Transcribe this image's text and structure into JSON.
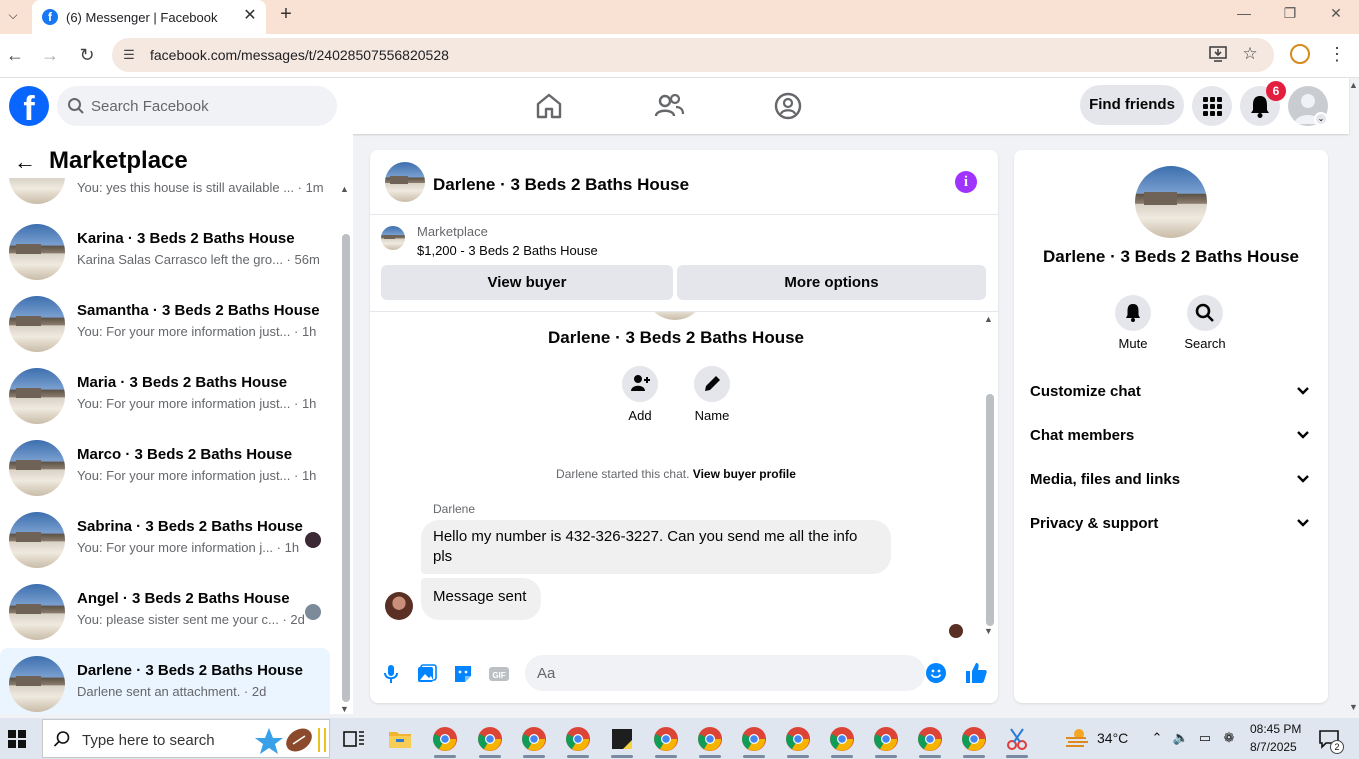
{
  "browser": {
    "tab_title": "(6) Messenger | Facebook",
    "url": "facebook.com/messages/t/24028507556820528"
  },
  "header": {
    "search_placeholder": "Search Facebook",
    "find_friends_label": "Find friends",
    "notification_count": "6",
    "brand_color": "#0866ff"
  },
  "sidebar": {
    "title": "Marketplace",
    "conversations": [
      {
        "name": "",
        "snippet": "You: yes this house is still available ... · 1m",
        "active": false
      },
      {
        "name": "Karina · 3 Beds 2 Baths House",
        "snippet": "Karina Salas Carrasco left the gro... · 56m",
        "active": false
      },
      {
        "name": "Samantha · 3 Beds 2 Baths House",
        "snippet": "You: For your more information just... · 1h",
        "active": false
      },
      {
        "name": "Maria · 3 Beds 2 Baths House",
        "snippet": "You: For your more information just... · 1h",
        "active": false
      },
      {
        "name": "Marco · 3 Beds 2 Baths House",
        "snippet": "You: For your more information just... · 1h",
        "active": false
      },
      {
        "name": "Sabrina · 3 Beds 2 Baths House",
        "snippet": "You: For your more information j... · 1h",
        "active": false
      },
      {
        "name": "Angel · 3 Beds 2 Baths House",
        "snippet": "You: please sister sent me your c... · 2d",
        "active": false
      },
      {
        "name": "Darlene · 3 Beds 2 Baths House",
        "snippet": "Darlene sent an attachment. · 2d",
        "active": true
      }
    ]
  },
  "chat": {
    "title": "Darlene · 3 Beds 2 Baths House",
    "marketplace_label": "Marketplace",
    "listing": "$1,200 - 3 Beds 2 Baths House",
    "view_buyer_label": "View buyer",
    "more_options_label": "More options",
    "profile_title": "Darlene · 3 Beds 2 Baths House",
    "add_label": "Add",
    "name_label": "Name",
    "started_text": "Darlene started this chat.",
    "view_profile_link": "View buyer profile",
    "sender_name": "Darlene",
    "messages": [
      {
        "text": "Hello my number is 432-326-3227.  Can you send me all the info pls"
      },
      {
        "text": "Message sent"
      }
    ],
    "composer_placeholder": "Aa",
    "accent_color": "#0084ff"
  },
  "info_panel": {
    "name": "Darlene · 3 Beds 2 Baths House",
    "mute_label": "Mute",
    "search_label": "Search",
    "sections": [
      {
        "label": "Customize chat"
      },
      {
        "label": "Chat members"
      },
      {
        "label": "Media, files and links"
      },
      {
        "label": "Privacy & support"
      }
    ]
  },
  "taskbar": {
    "search_placeholder": "Type here to search",
    "weather": "34°C",
    "time": "08:45 PM",
    "date": "8/7/2025",
    "notification_count": "2"
  }
}
